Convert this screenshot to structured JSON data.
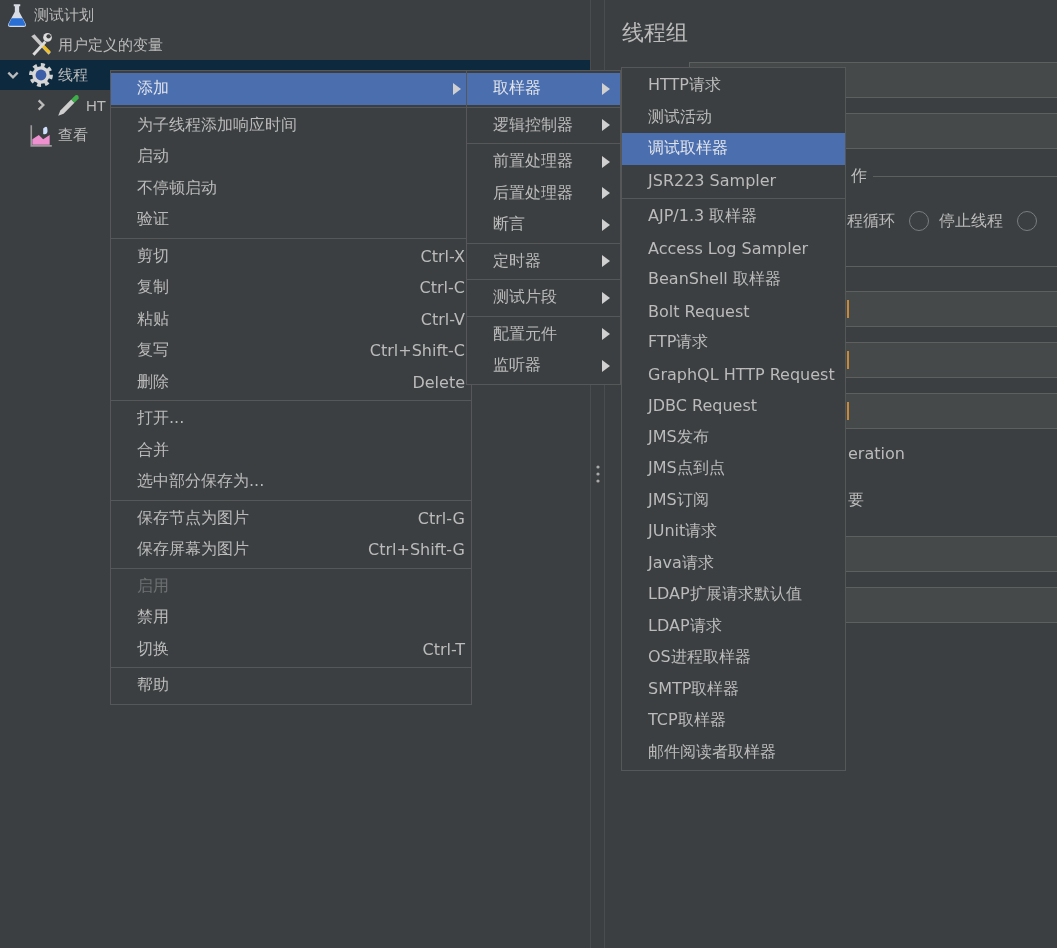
{
  "tree": [
    {
      "label": "测试计划",
      "kind": "test_plan",
      "selected": false,
      "children": [
        {
          "label": "用户定义的变量",
          "kind": "variables",
          "selected": false
        },
        {
          "label": "线程",
          "kind": "thread_group",
          "expanded": true,
          "selected": true,
          "children": [
            {
              "label": "HT",
              "kind": "sampler",
              "expanded": false,
              "selected": false
            }
          ]
        },
        {
          "label": "查看",
          "kind": "listener",
          "selected": false
        }
      ]
    }
  ],
  "right_panel": {
    "title": "线程组",
    "rows": [
      {
        "kind": "field",
        "cursor": false
      },
      {
        "kind": "field",
        "cursor": false
      },
      {
        "kind": "group",
        "text": "作"
      },
      {
        "kind": "radios",
        "items": [
          {
            "kind": "text",
            "text": "程循环"
          },
          {
            "kind": "radio",
            "selected": false
          },
          {
            "kind": "text",
            "text": "停止线程"
          },
          {
            "kind": "radio",
            "selected": false
          }
        ]
      },
      {
        "kind": "rule"
      },
      {
        "kind": "field",
        "cursor": true
      },
      {
        "kind": "field",
        "cursor": true
      },
      {
        "kind": "field",
        "cursor": true
      },
      {
        "kind": "text",
        "text": "eration"
      },
      {
        "kind": "text",
        "text": "要"
      },
      {
        "kind": "field",
        "cursor": false
      },
      {
        "kind": "field",
        "cursor": false
      }
    ]
  },
  "context_menu": {
    "groups": [
      [
        {
          "label": "添加",
          "submenu": true,
          "selected": true,
          "disabled": false
        }
      ],
      [
        {
          "label": "为子线程添加响应时间",
          "selected": false,
          "disabled": false
        },
        {
          "label": "启动",
          "selected": false,
          "disabled": false
        },
        {
          "label": "不停顿启动",
          "selected": false,
          "disabled": false
        },
        {
          "label": "验证",
          "selected": false,
          "disabled": false
        }
      ],
      [
        {
          "label": "剪切",
          "shortcut": "Ctrl-X",
          "selected": false,
          "disabled": false
        },
        {
          "label": "复制",
          "shortcut": "Ctrl-C",
          "selected": false,
          "disabled": false
        },
        {
          "label": "粘贴",
          "shortcut": "Ctrl-V",
          "selected": false,
          "disabled": false
        },
        {
          "label": "复写",
          "shortcut": "Ctrl+Shift-C",
          "selected": false,
          "disabled": false
        },
        {
          "label": "删除",
          "shortcut": "Delete",
          "selected": false,
          "disabled": false
        }
      ],
      [
        {
          "label": "打开...",
          "selected": false,
          "disabled": false
        },
        {
          "label": "合并",
          "selected": false,
          "disabled": false
        },
        {
          "label": "选中部分保存为...",
          "selected": false,
          "disabled": false
        }
      ],
      [
        {
          "label": "保存节点为图片",
          "shortcut": "Ctrl-G",
          "selected": false,
          "disabled": false
        },
        {
          "label": "保存屏幕为图片",
          "shortcut": "Ctrl+Shift-G",
          "selected": false,
          "disabled": false
        }
      ],
      [
        {
          "label": "启用",
          "selected": false,
          "disabled": true
        },
        {
          "label": "禁用",
          "selected": false,
          "disabled": false
        },
        {
          "label": "切换",
          "shortcut": "Ctrl-T",
          "selected": false,
          "disabled": false
        }
      ],
      [
        {
          "label": "帮助",
          "selected": false,
          "disabled": false
        }
      ]
    ]
  },
  "add_submenu": {
    "groups": [
      [
        {
          "label": "取样器",
          "submenu": true,
          "selected": true,
          "disabled": false
        }
      ],
      [
        {
          "label": "逻辑控制器",
          "submenu": true,
          "selected": false,
          "disabled": false
        }
      ],
      [
        {
          "label": "前置处理器",
          "submenu": true,
          "selected": false,
          "disabled": false
        },
        {
          "label": "后置处理器",
          "submenu": true,
          "selected": false,
          "disabled": false
        },
        {
          "label": "断言",
          "submenu": true,
          "selected": false,
          "disabled": false
        }
      ],
      [
        {
          "label": "定时器",
          "submenu": true,
          "selected": false,
          "disabled": false
        }
      ],
      [
        {
          "label": "测试片段",
          "submenu": true,
          "selected": false,
          "disabled": false
        }
      ],
      [
        {
          "label": "配置元件",
          "submenu": true,
          "selected": false,
          "disabled": false
        },
        {
          "label": "监听器",
          "submenu": true,
          "selected": false,
          "disabled": false
        }
      ]
    ]
  },
  "sampler_submenu": {
    "groups": [
      [
        {
          "label": "HTTP请求",
          "selected": false,
          "disabled": false
        },
        {
          "label": "测试活动",
          "selected": false,
          "disabled": false
        },
        {
          "label": "调试取样器",
          "selected": true,
          "disabled": false
        },
        {
          "label": "JSR223 Sampler",
          "selected": false,
          "disabled": false
        }
      ],
      [
        {
          "label": "AJP/1.3 取样器",
          "selected": false,
          "disabled": false
        },
        {
          "label": "Access Log Sampler",
          "selected": false,
          "disabled": false
        },
        {
          "label": "BeanShell 取样器",
          "selected": false,
          "disabled": false
        },
        {
          "label": "Bolt Request",
          "selected": false,
          "disabled": false
        },
        {
          "label": "FTP请求",
          "selected": false,
          "disabled": false
        },
        {
          "label": "GraphQL HTTP Request",
          "selected": false,
          "disabled": false
        },
        {
          "label": "JDBC Request",
          "selected": false,
          "disabled": false
        },
        {
          "label": "JMS发布",
          "selected": false,
          "disabled": false
        },
        {
          "label": "JMS点到点",
          "selected": false,
          "disabled": false
        },
        {
          "label": "JMS订阅",
          "selected": false,
          "disabled": false
        },
        {
          "label": "JUnit请求",
          "selected": false,
          "disabled": false
        },
        {
          "label": "Java请求",
          "selected": false,
          "disabled": false
        },
        {
          "label": "LDAP扩展请求默认值",
          "selected": false,
          "disabled": false
        },
        {
          "label": "LDAP请求",
          "selected": false,
          "disabled": false
        },
        {
          "label": "OS进程取样器",
          "selected": false,
          "disabled": false
        },
        {
          "label": "SMTP取样器",
          "selected": false,
          "disabled": false
        },
        {
          "label": "TCP取样器",
          "selected": false,
          "disabled": false
        },
        {
          "label": "邮件阅读者取样器",
          "selected": false,
          "disabled": false
        }
      ]
    ]
  }
}
